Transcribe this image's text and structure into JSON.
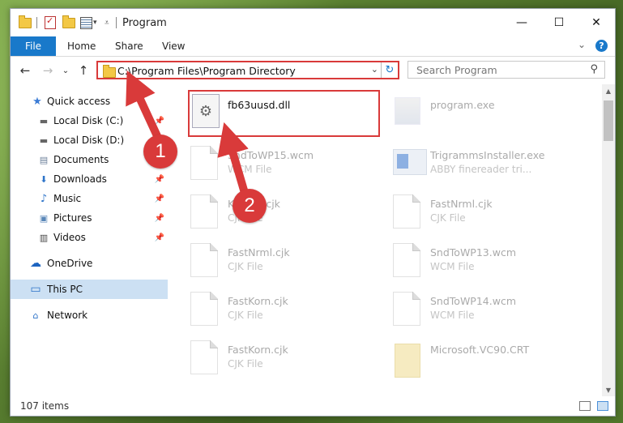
{
  "window": {
    "title": "Program",
    "controls": {
      "minimize": "—",
      "maximize": "☐",
      "close": "✕"
    }
  },
  "ribbon": {
    "tabs": [
      "File",
      "Home",
      "Share",
      "View"
    ],
    "expand": "⌄",
    "help": "?"
  },
  "nav": {
    "back": "←",
    "forward": "→",
    "recent": "⌄",
    "up": "↑",
    "address": "C:\\Program Files\\Program Directory",
    "address_dropdown": "⌄",
    "refresh": "↻",
    "search_placeholder": "Search Program",
    "search_icon": "⚲"
  },
  "sidebar": {
    "items": [
      {
        "label": "Quick access",
        "icon": "star-icon",
        "glyph": "★",
        "pinned": false
      },
      {
        "label": "Local Disk (C:)",
        "icon": "drive-icon",
        "glyph": "▬",
        "pinned": true
      },
      {
        "label": "Local Disk (D:)",
        "icon": "drive-icon",
        "glyph": "▬",
        "pinned": false
      },
      {
        "label": "Documents",
        "icon": "documents-icon",
        "glyph": "▤",
        "pinned": true
      },
      {
        "label": "Downloads",
        "icon": "download-icon",
        "glyph": "⬇",
        "pinned": true
      },
      {
        "label": "Music",
        "icon": "music-icon",
        "glyph": "♪",
        "pinned": true
      },
      {
        "label": "Pictures",
        "icon": "pictures-icon",
        "glyph": "▣",
        "pinned": true
      },
      {
        "label": "Videos",
        "icon": "videos-icon",
        "glyph": "▥",
        "pinned": true
      },
      {
        "label": "OneDrive",
        "icon": "cloud-icon",
        "glyph": "☁",
        "pinned": false
      },
      {
        "label": "This PC",
        "icon": "computer-icon",
        "glyph": "▭",
        "pinned": false,
        "selected": true
      },
      {
        "label": "Network",
        "icon": "network-icon",
        "glyph": "⌂",
        "pinned": false
      }
    ],
    "pin_glyph": "📌"
  },
  "files": [
    {
      "name": "fb63uusd.dll",
      "type": "",
      "faded": false,
      "highlighted": true
    },
    {
      "name": "program.exe",
      "type": "",
      "faded": true
    },
    {
      "name": "SndToWP15.wcm",
      "type": "WCM File",
      "faded": true
    },
    {
      "name": "TrigrammsInstaller.exe",
      "type": "ABBY finereader tri...",
      "faded": true
    },
    {
      "name": "Korean.cjk",
      "type": "CJK File",
      "faded": true
    },
    {
      "name": "FastNrml.cjk",
      "type": "CJK File",
      "faded": true
    },
    {
      "name": "FastNrml.cjk",
      "type": "CJK File",
      "faded": true
    },
    {
      "name": "SndToWP13.wcm",
      "type": "WCM File",
      "faded": true
    },
    {
      "name": "FastKorn.cjk",
      "type": "CJK File",
      "faded": true
    },
    {
      "name": "SndToWP14.wcm",
      "type": "WCM File",
      "faded": true
    },
    {
      "name": "FastKorn.cjk",
      "type": "CJK File",
      "faded": true
    },
    {
      "name": "Microsoft.VC90.CRT",
      "type": "",
      "faded": true
    }
  ],
  "status": {
    "count": "107 items"
  },
  "annotations": {
    "step1": "1",
    "step2": "2",
    "color": "#d93a3a"
  }
}
